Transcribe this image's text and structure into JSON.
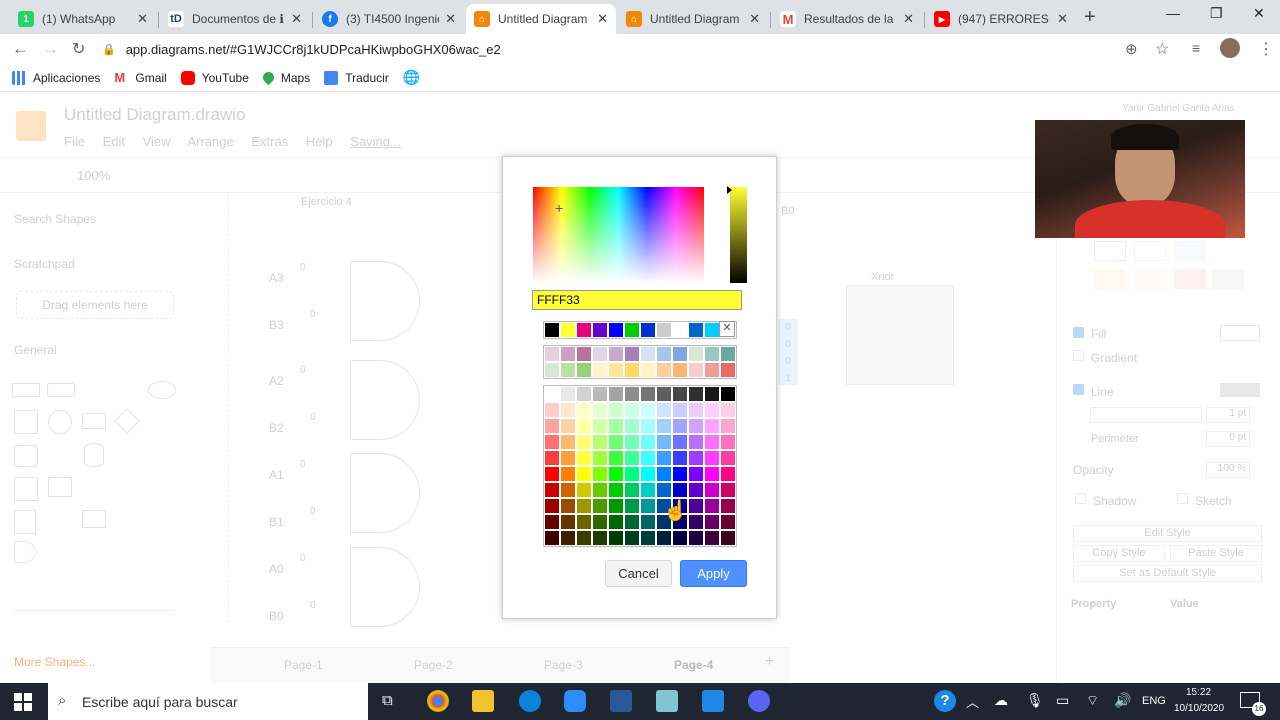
{
  "browser": {
    "tabs": [
      {
        "title": "(1) WhatsApp",
        "icon": "whatsapp-icon",
        "color": "#25d366",
        "glyph": "1"
      },
      {
        "title": "Documentos de ℹ",
        "icon": "td-icon",
        "color": "#ffffff",
        "glyph": "tD"
      },
      {
        "title": "(3) TI4500 Ingenie",
        "icon": "facebook-icon",
        "color": "#1877f2",
        "glyph": "f"
      },
      {
        "title": "Untitled Diagram",
        "icon": "drawio-icon",
        "color": "#f08705",
        "glyph": "⌂"
      },
      {
        "title": "Untitled Diagram",
        "icon": "drawio-icon",
        "color": "#f08705",
        "glyph": "⌂"
      },
      {
        "title": "Resultados de la b",
        "icon": "gmail-icon",
        "color": "#ffffff",
        "glyph": "M"
      },
      {
        "title": "(947) ERRORES de",
        "icon": "youtube-icon",
        "color": "#ff0000",
        "glyph": "▶"
      }
    ],
    "address": "app.diagrams.net/#G1WJCCr8j1kUDPcaHKiwpboGHX06wac_e2",
    "bookmarks": [
      {
        "label": "Aplicaciones",
        "color": "#4285f4"
      },
      {
        "label": "Gmail",
        "color": "#ea4335"
      },
      {
        "label": "YouTube",
        "color": "#ff0000"
      },
      {
        "label": "Maps",
        "color": "#34a853"
      },
      {
        "label": "Traducir",
        "color": "#4285f4"
      }
    ]
  },
  "app": {
    "title": "Untitled Diagram.drawio",
    "menus": [
      "File",
      "Edit",
      "View",
      "Arrange",
      "Extras",
      "Help"
    ],
    "saving": "Saving...",
    "zoom": "100%",
    "search_placeholder": "Search Shapes",
    "scratchpad": "Scratchpad",
    "drag_hint": "Drag elements here",
    "general": "General",
    "more_shapes": "More Shapes...",
    "diagram_label": "Ejercicio 4",
    "xnor_label": "Xnor",
    "b0_label": "B0",
    "inputs": [
      "A3",
      "B3",
      "A2",
      "B2",
      "A1",
      "B1",
      "A0",
      "B0"
    ],
    "zeros": [
      "0",
      "0",
      "0",
      "0",
      "0",
      "0",
      "0",
      "0"
    ],
    "table_values": [
      "0",
      "0",
      "0",
      "1"
    ],
    "pages": [
      "Page-1",
      "Page-2",
      "Page-3",
      "Page-4"
    ],
    "user": "Yanir Gabriel Garita Arias",
    "format": {
      "fill": "Fill",
      "gradient": "Gradient",
      "line": "Line",
      "line_width": "1 pt",
      "perimeter": "Perimeter",
      "perimeter_value": "0 pt",
      "opacity": "Opacity",
      "opacity_value": "100 %",
      "shadow": "Shadow",
      "sketch": "Sketch",
      "edit_style": "Edit Style",
      "copy_style": "Copy Style",
      "paste_style": "Paste Style",
      "set_default": "Set as Default Style",
      "property": "Property",
      "value": "Value"
    }
  },
  "dialog": {
    "hex": "FFFF33",
    "cancel": "Cancel",
    "apply": "Apply",
    "row1": [
      "#000000",
      "#ffff33",
      "#e6007e",
      "#6600cc",
      "#0000ff",
      "#00cc00",
      "#0033cc",
      "#cccccc",
      "#ffffff",
      "#0066cc",
      "#00ccff",
      "#33cc33"
    ],
    "row2": [
      "#e6d0de",
      "#cda2be",
      "#b5739d",
      "#e1d5e7",
      "#c3abd0",
      "#a680b8",
      "#d4e1f5",
      "#a9c4eb",
      "#7ea6e0",
      "#d5e8d4",
      "#9ac7bf",
      "#67ab9f"
    ],
    "row3": [
      "#d5e8d4",
      "#b9e0a5",
      "#97d077",
      "#fff2cc",
      "#ffe599",
      "#ffd966",
      "#fff4c3",
      "#ffce9f",
      "#ffb570",
      "#f8cecc",
      "#f19c99",
      "#ea6b66"
    ]
  },
  "taskbar": {
    "search": "Escribe aquí para buscar",
    "lang": "ENG",
    "time": "15:22",
    "date": "10/10/2020",
    "notif": "16"
  }
}
